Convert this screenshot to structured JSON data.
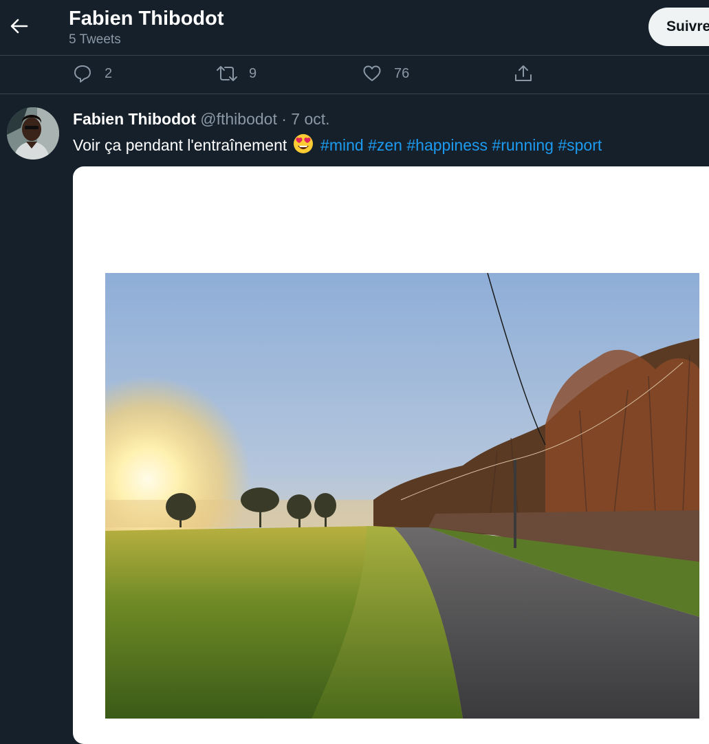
{
  "header": {
    "title": "Fabien Thibodot",
    "subtitle": "5 Tweets",
    "follow_label": "Suivre"
  },
  "prev_tweet_actions": {
    "replies": "2",
    "retweets": "9",
    "likes": "76"
  },
  "tweet": {
    "author_name": "Fabien Thibodot",
    "handle": "@fthibodot",
    "separator": "·",
    "date": "7 oct.",
    "text": "Voir ça pendant l'entraînement",
    "emoji": "😍",
    "hashtags": [
      "#mind",
      "#zen",
      "#happiness",
      "#running",
      "#sport"
    ]
  },
  "colors": {
    "background": "#15202b",
    "border": "#38444d",
    "secondary_text": "#8b98a5",
    "accent": "#1d9bf0"
  },
  "icons": [
    "back-arrow-icon",
    "reply-icon",
    "retweet-icon",
    "like-icon",
    "share-icon"
  ]
}
